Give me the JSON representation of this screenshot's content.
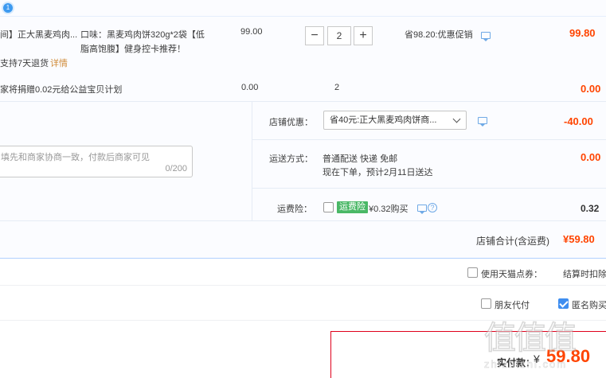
{
  "badge": "1",
  "item": {
    "title": "间】正大黑麦鸡肉...",
    "sku_line1": "口味：黑麦鸡肉饼320g*2袋【低",
    "sku_line2": "脂高饱腹】健身控卡推荐！",
    "unit_price": "99.00",
    "qty_minus": "−",
    "qty_value": "2",
    "qty_plus": "+",
    "promo": "省98.20:优惠促销",
    "subtotal": "99.80",
    "return_policy": "支持7天退货",
    "return_detail": "详情"
  },
  "charity": {
    "label": "家将捐赠0.02元给公益宝贝计划",
    "price": "0.00",
    "qty": "2",
    "subtotal": "0.00"
  },
  "shop_discount": {
    "label": "店铺优惠：",
    "selected": "省40元:正大黑麦鸡肉饼商...",
    "amount": "-40.00"
  },
  "message": {
    "placeholder": "填先和商家协商一致，付款后商家可见",
    "counter": "0/200"
  },
  "shipping": {
    "label": "运送方式：",
    "method": "普通配送 快递 免邮",
    "eta": "现在下单，预计2月11日送达",
    "amount": "0.00"
  },
  "insurance": {
    "label": "运费险：",
    "tag": "运费险",
    "price_text": "¥0.32购买",
    "help": "?",
    "amount": "0.32"
  },
  "shop_total": {
    "label": "店铺合计(含运费)",
    "amount": "¥59.80"
  },
  "tmall_points": {
    "label": "使用天猫点券：",
    "note": "结算时扣除"
  },
  "options": {
    "friend_pay": "朋友代付",
    "anonymous": "匿名购买"
  },
  "pay": {
    "label": "实付款：",
    "currency": "¥",
    "amount": "59.80"
  },
  "watermark": {
    "chars": "值值值",
    "url": "zhizhizhi.com"
  },
  "colors": {
    "accent_red": "#ff4400",
    "link_blue": "#3d9af0",
    "check_blue": "#3f8ef0",
    "insurance_green": "#4ab866"
  }
}
